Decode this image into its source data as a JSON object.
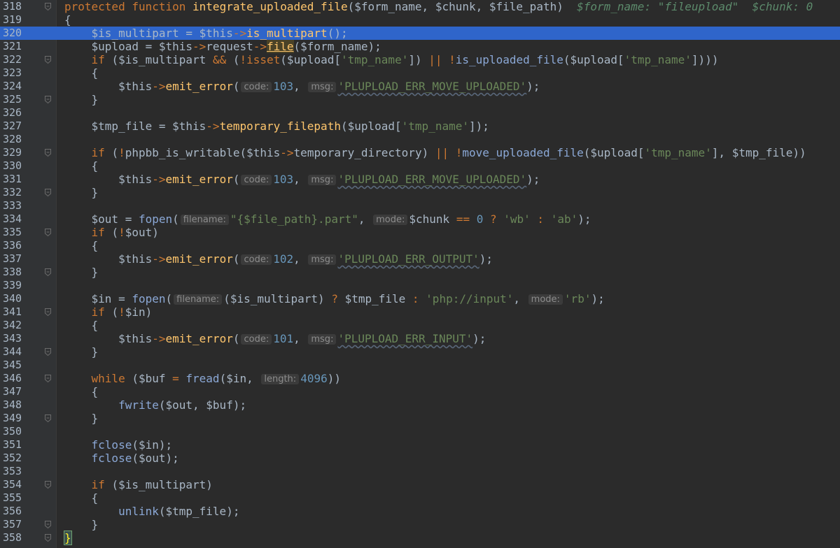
{
  "editor": {
    "current_line": 320,
    "lines": [
      {
        "n": "318",
        "tokens": [
          [
            "kw",
            "protected function "
          ],
          [
            "fn",
            "integrate_uploaded_file"
          ],
          [
            "plain",
            "($form_name, $chunk, $file_path)"
          ],
          [
            "plain",
            "  "
          ],
          [
            "tail",
            "$form_name: \"fileupload\"  $chunk: 0"
          ]
        ]
      },
      {
        "n": "319",
        "tokens": [
          [
            "plain",
            "{"
          ]
        ]
      },
      {
        "n": "320",
        "tokens": [
          [
            "plain",
            "    $is_multipart "
          ],
          [
            "plain",
            "= "
          ],
          [
            "plain",
            "$this"
          ],
          [
            "op",
            "->"
          ],
          [
            "fn",
            "is_multipart"
          ],
          [
            "plain",
            "();"
          ]
        ]
      },
      {
        "n": "321",
        "tokens": [
          [
            "plain",
            "    $upload = $this"
          ],
          [
            "op",
            "->"
          ],
          [
            "plain",
            "request"
          ],
          [
            "op",
            "->"
          ],
          [
            "fnb",
            "file"
          ],
          [
            "plain",
            "($form_name);"
          ]
        ]
      },
      {
        "n": "322",
        "tokens": [
          [
            "kw",
            "    if "
          ],
          [
            "plain",
            "($is_multipart "
          ],
          [
            "op",
            "&& "
          ],
          [
            "plain",
            "("
          ],
          [
            "op",
            "!"
          ],
          [
            "kw",
            "isset"
          ],
          [
            "plain",
            "($upload["
          ],
          [
            "str",
            "'tmp_name'"
          ],
          [
            "plain",
            "]) "
          ],
          [
            "op",
            "|| !"
          ],
          [
            "phpfn",
            "is_uploaded_file"
          ],
          [
            "plain",
            "($upload["
          ],
          [
            "str",
            "'tmp_name'"
          ],
          [
            "plain",
            "])))"
          ]
        ]
      },
      {
        "n": "323",
        "tokens": [
          [
            "plain",
            "    {"
          ]
        ]
      },
      {
        "n": "324",
        "tokens": [
          [
            "plain",
            "        $this"
          ],
          [
            "op",
            "->"
          ],
          [
            "fn",
            "emit_error"
          ],
          [
            "plain",
            "("
          ],
          [
            "hint",
            "code:"
          ],
          [
            "num",
            "103"
          ],
          [
            "plain",
            ", "
          ],
          [
            "hint",
            "msg:"
          ],
          [
            "err",
            "'PLUPLOAD_ERR_MOVE_UPLOADED'"
          ],
          [
            "plain",
            ");"
          ]
        ]
      },
      {
        "n": "325",
        "tokens": [
          [
            "plain",
            "    }"
          ]
        ]
      },
      {
        "n": "326",
        "tokens": []
      },
      {
        "n": "327",
        "tokens": [
          [
            "plain",
            "    $tmp_file = $this"
          ],
          [
            "op",
            "->"
          ],
          [
            "fn",
            "temporary_filepath"
          ],
          [
            "plain",
            "($upload["
          ],
          [
            "str",
            "'tmp_name'"
          ],
          [
            "plain",
            "]);"
          ]
        ]
      },
      {
        "n": "328",
        "tokens": []
      },
      {
        "n": "329",
        "tokens": [
          [
            "kw",
            "    if "
          ],
          [
            "plain",
            "("
          ],
          [
            "op",
            "!"
          ],
          [
            "plain",
            "phpbb_is_writable($this"
          ],
          [
            "op",
            "->"
          ],
          [
            "plain",
            "temporary_directory) "
          ],
          [
            "op",
            "|| !"
          ],
          [
            "phpfn",
            "move_uploaded_file"
          ],
          [
            "plain",
            "($upload["
          ],
          [
            "str",
            "'tmp_name'"
          ],
          [
            "plain",
            "], $tmp_file))"
          ]
        ]
      },
      {
        "n": "330",
        "tokens": [
          [
            "plain",
            "    {"
          ]
        ]
      },
      {
        "n": "331",
        "tokens": [
          [
            "plain",
            "        $this"
          ],
          [
            "op",
            "->"
          ],
          [
            "fn",
            "emit_error"
          ],
          [
            "plain",
            "("
          ],
          [
            "hint",
            "code:"
          ],
          [
            "num",
            "103"
          ],
          [
            "plain",
            ", "
          ],
          [
            "hint",
            "msg:"
          ],
          [
            "err",
            "'PLUPLOAD_ERR_MOVE_UPLOADED'"
          ],
          [
            "plain",
            ");"
          ]
        ]
      },
      {
        "n": "332",
        "tokens": [
          [
            "plain",
            "    }"
          ]
        ]
      },
      {
        "n": "333",
        "tokens": []
      },
      {
        "n": "334",
        "tokens": [
          [
            "plain",
            "    $out = "
          ],
          [
            "phpfn",
            "fopen"
          ],
          [
            "plain",
            "("
          ],
          [
            "hint",
            "filename:"
          ],
          [
            "str",
            "\"{$file_path}.part\""
          ],
          [
            "plain",
            ", "
          ],
          [
            "hint",
            "mode:"
          ],
          [
            "plain",
            "$chunk "
          ],
          [
            "op",
            "== "
          ],
          [
            "num",
            "0 "
          ],
          [
            "op",
            "? "
          ],
          [
            "str",
            "'wb' "
          ],
          [
            "op",
            ": "
          ],
          [
            "str",
            "'ab'"
          ],
          [
            "plain",
            ");"
          ]
        ]
      },
      {
        "n": "335",
        "tokens": [
          [
            "kw",
            "    if "
          ],
          [
            "plain",
            "("
          ],
          [
            "op",
            "!"
          ],
          [
            "plain",
            "$out)"
          ]
        ]
      },
      {
        "n": "336",
        "tokens": [
          [
            "plain",
            "    {"
          ]
        ]
      },
      {
        "n": "337",
        "tokens": [
          [
            "plain",
            "        $this"
          ],
          [
            "op",
            "->"
          ],
          [
            "fn",
            "emit_error"
          ],
          [
            "plain",
            "("
          ],
          [
            "hint",
            "code:"
          ],
          [
            "num",
            "102"
          ],
          [
            "plain",
            ", "
          ],
          [
            "hint",
            "msg:"
          ],
          [
            "err",
            "'PLUPLOAD_ERR_OUTPUT'"
          ],
          [
            "plain",
            ");"
          ]
        ]
      },
      {
        "n": "338",
        "tokens": [
          [
            "plain",
            "    }"
          ]
        ]
      },
      {
        "n": "339",
        "tokens": []
      },
      {
        "n": "340",
        "tokens": [
          [
            "plain",
            "    $in = "
          ],
          [
            "phpfn",
            "fopen"
          ],
          [
            "plain",
            "("
          ],
          [
            "hint",
            "filename:"
          ],
          [
            "plain",
            "($is_multipart) "
          ],
          [
            "op",
            "? "
          ],
          [
            "plain",
            "$tmp_file "
          ],
          [
            "op",
            ": "
          ],
          [
            "str",
            "'php://input'"
          ],
          [
            "plain",
            ", "
          ],
          [
            "hint",
            "mode:"
          ],
          [
            "str",
            "'rb'"
          ],
          [
            "plain",
            ");"
          ]
        ]
      },
      {
        "n": "341",
        "tokens": [
          [
            "kw",
            "    if "
          ],
          [
            "plain",
            "("
          ],
          [
            "op",
            "!"
          ],
          [
            "plain",
            "$in)"
          ]
        ]
      },
      {
        "n": "342",
        "tokens": [
          [
            "plain",
            "    {"
          ]
        ]
      },
      {
        "n": "343",
        "tokens": [
          [
            "plain",
            "        $this"
          ],
          [
            "op",
            "->"
          ],
          [
            "fn",
            "emit_error"
          ],
          [
            "plain",
            "("
          ],
          [
            "hint",
            "code:"
          ],
          [
            "num",
            "101"
          ],
          [
            "plain",
            ", "
          ],
          [
            "hint",
            "msg:"
          ],
          [
            "err",
            "'PLUPLOAD_ERR_INPUT'"
          ],
          [
            "plain",
            ");"
          ]
        ]
      },
      {
        "n": "344",
        "tokens": [
          [
            "plain",
            "    }"
          ]
        ]
      },
      {
        "n": "345",
        "tokens": []
      },
      {
        "n": "346",
        "tokens": [
          [
            "kw",
            "    while "
          ],
          [
            "plain",
            "($buf "
          ],
          [
            "op",
            "= "
          ],
          [
            "phpfn",
            "fread"
          ],
          [
            "plain",
            "($in, "
          ],
          [
            "hint",
            "length:"
          ],
          [
            "num",
            "4096"
          ],
          [
            "plain",
            "))"
          ]
        ]
      },
      {
        "n": "347",
        "tokens": [
          [
            "plain",
            "    {"
          ]
        ]
      },
      {
        "n": "348",
        "tokens": [
          [
            "plain",
            "        "
          ],
          [
            "phpfn",
            "fwrite"
          ],
          [
            "plain",
            "($out, $buf);"
          ]
        ]
      },
      {
        "n": "349",
        "tokens": [
          [
            "plain",
            "    }"
          ]
        ]
      },
      {
        "n": "350",
        "tokens": []
      },
      {
        "n": "351",
        "tokens": [
          [
            "plain",
            "    "
          ],
          [
            "phpfn",
            "fclose"
          ],
          [
            "plain",
            "($in);"
          ]
        ]
      },
      {
        "n": "352",
        "tokens": [
          [
            "plain",
            "    "
          ],
          [
            "phpfn",
            "fclose"
          ],
          [
            "plain",
            "($out);"
          ]
        ]
      },
      {
        "n": "353",
        "tokens": []
      },
      {
        "n": "354",
        "tokens": [
          [
            "kw",
            "    if "
          ],
          [
            "plain",
            "($is_multipart)"
          ]
        ]
      },
      {
        "n": "355",
        "tokens": [
          [
            "plain",
            "    {"
          ]
        ]
      },
      {
        "n": "356",
        "tokens": [
          [
            "plain",
            "        "
          ],
          [
            "phpfn",
            "unlink"
          ],
          [
            "plain",
            "($tmp_file);"
          ]
        ]
      },
      {
        "n": "357",
        "tokens": [
          [
            "plain",
            "    }"
          ]
        ]
      },
      {
        "n": "358",
        "tokens": [
          [
            "bracket",
            "}"
          ]
        ]
      }
    ],
    "fold_lines": [
      "318",
      "322",
      "325",
      "329",
      "332",
      "335",
      "338",
      "341",
      "344",
      "346",
      "349",
      "354",
      "357",
      "358"
    ],
    "colors": {
      "background": "#2b2b2b",
      "gutter": "#313335",
      "current_line": "#2f65ca",
      "keyword": "#cc7832",
      "function": "#ffc66d",
      "string": "#6a8759",
      "number": "#6897bb"
    }
  }
}
